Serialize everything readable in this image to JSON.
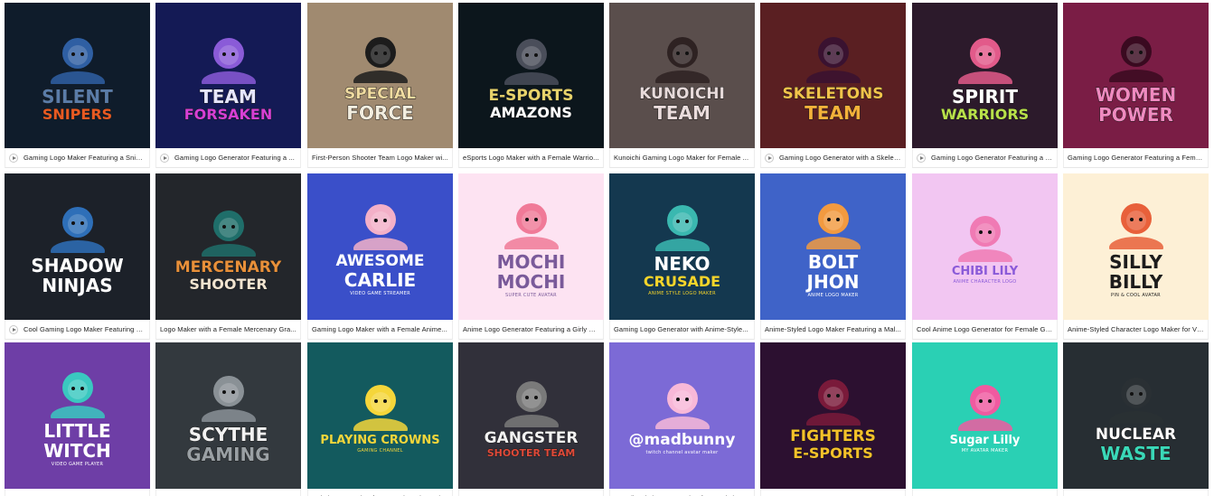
{
  "cards": [
    {
      "bg": "#0f1c2b",
      "t1": "SILENT",
      "t2": "SNIPERS",
      "t3": "",
      "c1": "#5a7ca8",
      "c2": "#e85a22",
      "fig": "#2f5fa3",
      "cap": "Gaming Logo Maker Featuring a Snip...",
      "play": true
    },
    {
      "bg": "#141a55",
      "t1": "TEAM",
      "t2": "FORSAKEN",
      "t3": "",
      "c1": "#e6e6ff",
      "c2": "#d63fd6",
      "fig": "#8a5bd8",
      "cap": "Gaming Logo Generator Featuring a ...",
      "play": true
    },
    {
      "bg": "#a08a70",
      "t1": "SPECIAL",
      "t2": "FORCE",
      "t3": "",
      "c1": "#f0dba0",
      "c2": "#f3eee0",
      "fig": "#1c1c1c",
      "cap": "First-Person Shooter Team Logo Maker wi...",
      "play": false
    },
    {
      "bg": "#0c161c",
      "t1": "E-SPORTS",
      "t2": "AMAZONS",
      "t3": "",
      "c1": "#e7d36b",
      "c2": "#ffffff",
      "fig": "#4a4e5a",
      "cap": "eSports Logo Maker with a Female Warrio...",
      "play": false
    },
    {
      "bg": "#5a4e4c",
      "t1": "KUNOICHI",
      "t2": "TEAM",
      "t3": "",
      "c1": "#e7dada",
      "c2": "#eadcdc",
      "fig": "#2e2222",
      "cap": "Kunoichi Gaming Logo Maker for Female ...",
      "play": false
    },
    {
      "bg": "#5a1f22",
      "t1": "SKELETONS",
      "t2": "TEAM",
      "t3": "",
      "c1": "#f2c34a",
      "c2": "#f5b13a",
      "fig": "#3a1230",
      "cap": "Gaming Logo Generator with a Skelet...",
      "play": true
    },
    {
      "bg": "#2c1a2b",
      "t1": "SPIRIT",
      "t2": "WARRIORS",
      "t3": "",
      "c1": "#ffffff",
      "c2": "#b8e04a",
      "fig": "#e25a8a",
      "cap": "Gaming Logo Generator Featuring a F...",
      "play": true
    },
    {
      "bg": "#7a1d45",
      "t1": "WOMEN",
      "t2": "POWER",
      "t3": "",
      "c1": "#f08ac0",
      "c2": "#f08ac0",
      "fig": "#3a0a20",
      "cap": "Gaming Logo Generator Featuring a Fema...",
      "play": false
    },
    {
      "bg": "#1c2129",
      "t1": "SHADOW",
      "t2": "NINJAS",
      "t3": "",
      "c1": "#ffffff",
      "c2": "#ffffff",
      "fig": "#2e6fb8",
      "cap": "Cool Gaming Logo Maker Featuring a ...",
      "play": true
    },
    {
      "bg": "#23262b",
      "t1": "MERCENARY",
      "t2": "SHOOTER",
      "t3": "",
      "c1": "#e8903a",
      "c2": "#f1e4d0",
      "fig": "#1f6e6a",
      "cap": "Logo Maker with a Female Mercenary Gra...",
      "play": false
    },
    {
      "bg": "#3a4fc9",
      "t1": "AWESOME",
      "t2": "CARLIE",
      "t3": "VIDEO GAME STREAMER",
      "c1": "#ffffff",
      "c2": "#ffffff",
      "fig": "#f3b0c8",
      "cap": "Gaming Logo Maker with a Female Anime...",
      "play": false
    },
    {
      "bg": "#fde3f2",
      "t1": "MOCHI",
      "t2": "MOCHI",
      "t3": "SUPER CUTE AVATAR",
      "c1": "#7a5a9a",
      "c2": "#7a5a9a",
      "fig": "#f07a98",
      "cap": "Anime Logo Generator Featuring a Girly C...",
      "play": false
    },
    {
      "bg": "#14384f",
      "t1": "NEKO",
      "t2": "CRUSADE",
      "t3": "ANIME STYLE LOGO MAKER",
      "c1": "#ffffff",
      "c2": "#f6d52a",
      "fig": "#3ab8b0",
      "cap": "Gaming Logo Generator with Anime-Style...",
      "play": false
    },
    {
      "bg": "#3f63c8",
      "t1": "BOLT",
      "t2": "JHON",
      "t3": "ANIME LOGO MAKER",
      "c1": "#ffffff",
      "c2": "#ffffff",
      "fig": "#f29a40",
      "cap": "Anime-Styled Logo Maker Featuring a Mal...",
      "play": false
    },
    {
      "bg": "#f2c6f2",
      "t1": "CHIBI LILY",
      "t2": "",
      "t3": "ANIME CHARACTER LOGO",
      "c1": "#8a5ad8",
      "c2": "#8a5ad8",
      "fig": "#f07ab4",
      "cap": "Cool Anime Logo Generator for Female Ga...",
      "play": false
    },
    {
      "bg": "#fdf0d6",
      "t1": "SILLY",
      "t2": "BILLY",
      "t3": "PIN & COOL AVATAR",
      "c1": "#1c1c1c",
      "c2": "#1c1c1c",
      "fig": "#e8603a",
      "cap": "Anime-Styled Character Logo Maker for Vi...",
      "play": false
    },
    {
      "bg": "#6e3ea6",
      "t1": "LITTLE",
      "t2": "WITCH",
      "t3": "VIDEO GAME PLAYER",
      "c1": "#ffffff",
      "c2": "#ffffff",
      "fig": "#3ac8c0",
      "cap": "",
      "play": false
    },
    {
      "bg": "#33393e",
      "t1": "SCYTHE",
      "t2": "GAMING",
      "t3": "",
      "c1": "#f2f2f2",
      "c2": "#9aa0a4",
      "fig": "#8a9196",
      "cap": "",
      "play": false
    },
    {
      "bg": "#135a5e",
      "t1": "PLAYING CROWNS",
      "t2": "",
      "t3": "GAMING CHANNEL",
      "c1": "#f5d63a",
      "c2": "#f5d63a",
      "fig": "#f5d63a",
      "cap": "Twitch Logo Maker for a Gaming Channel",
      "play": false
    },
    {
      "bg": "#31303a",
      "t1": "GANGSTER",
      "t2": "SHOOTER TEAM",
      "t3": "",
      "c1": "#f3f3f3",
      "c2": "#e04a3a",
      "fig": "#7a7a7a",
      "cap": "",
      "play": false
    },
    {
      "bg": "#7c6ad6",
      "t1": "@madbunny",
      "t2": "",
      "t3": "twitch channel avatar maker",
      "c1": "#ffffff",
      "c2": "#ffffff",
      "fig": "#f8b8d8",
      "cap": "Kawaii Twitch Avatar Maker for a Twitch Channel",
      "play": false
    },
    {
      "bg": "#2c1030",
      "t1": "FIGHTERS",
      "t2": "E-SPORTS",
      "t3": "",
      "c1": "#f5c12a",
      "c2": "#f5c12a",
      "fig": "#7a1a3a",
      "cap": "",
      "play": false
    },
    {
      "bg": "#2ad0b4",
      "t1": "Sugar Lilly",
      "t2": "",
      "t3": "MY AVATAR MAKER",
      "c1": "#ffffff",
      "c2": "#ffffff",
      "fig": "#f05aa0",
      "cap": "",
      "play": false
    },
    {
      "bg": "#272e33",
      "t1": "NUCLEAR",
      "t2": "WASTE",
      "t3": "",
      "c1": "#ffffff",
      "c2": "#3ad8b8",
      "fig": "#2a3034",
      "cap": "",
      "play": false
    }
  ]
}
